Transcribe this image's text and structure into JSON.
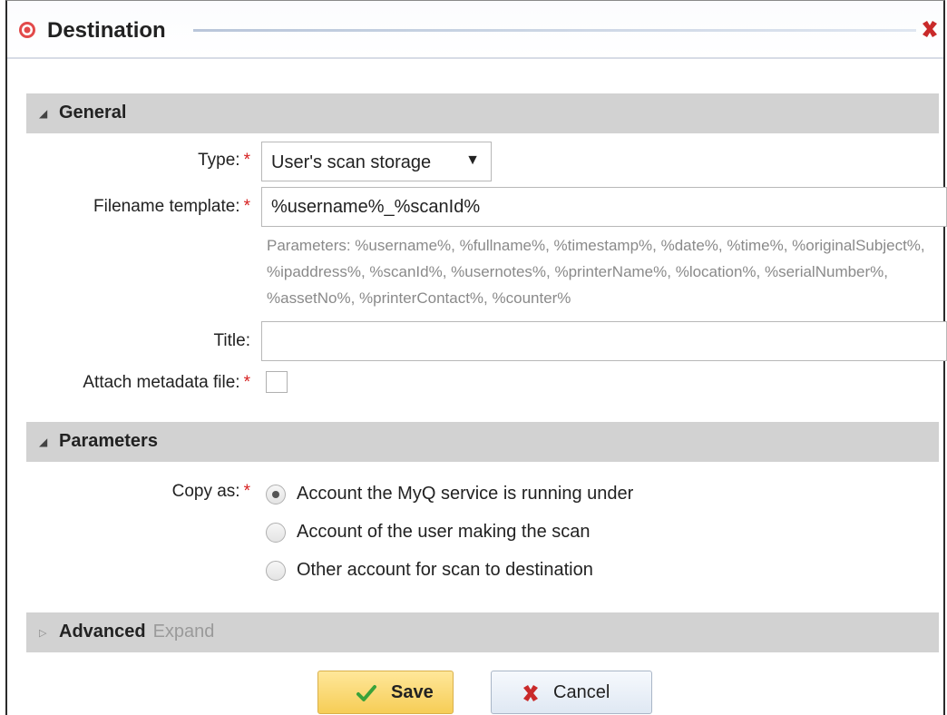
{
  "dialog": {
    "title": "Destination",
    "icon": "target-icon",
    "close_icon": "close-x-icon"
  },
  "general": {
    "title": "General",
    "type_label": "Type:",
    "type_value": "User's scan storage",
    "filename_label": "Filename template:",
    "filename_value": "%username%_%scanId%",
    "parameters_hint": "Parameters: %username%, %fullname%, %timestamp%, %date%, %time%, %originalSubject%, %ipaddress%, %scanId%, %usernotes%, %printerName%, %location%, %serialNumber%, %assetNo%, %printerContact%, %counter%",
    "title_label": "Title:",
    "title_value": "",
    "metadata_label": "Attach metadata file:",
    "required_mark": "*"
  },
  "parameters": {
    "title": "Parameters",
    "copy_as_label": "Copy as:",
    "options": [
      {
        "label": "Account the MyQ service is running under",
        "checked": true
      },
      {
        "label": "Account of the user making the scan",
        "checked": false
      },
      {
        "label": "Other account for scan to destination",
        "checked": false
      }
    ]
  },
  "advanced": {
    "title": "Advanced",
    "expand_label": "Expand"
  },
  "buttons": {
    "save": "Save",
    "cancel": "Cancel"
  },
  "colors": {
    "required": "#d62020",
    "section_bg": "#d2d2d2",
    "save_bg": "#f6cd56"
  }
}
